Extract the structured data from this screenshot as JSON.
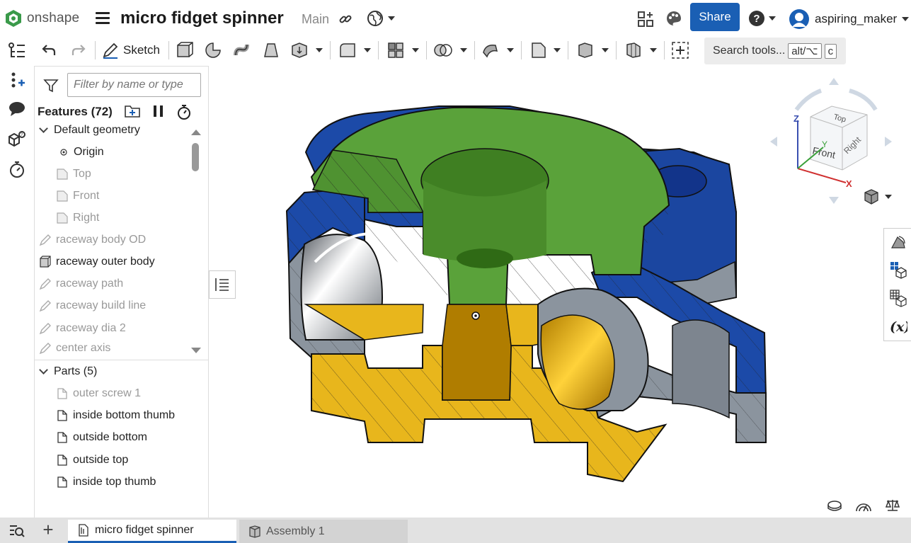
{
  "header": {
    "logo_text": "onshape",
    "doc_title": "micro fidget spinner",
    "branch": "Main",
    "share_label": "Share",
    "user_name": "aspiring_maker"
  },
  "toolbar": {
    "sketch_label": "Sketch",
    "search_label": "Search tools...",
    "shortcut_key1": "alt/⌥",
    "shortcut_key2": "c"
  },
  "panel": {
    "filter_placeholder": "Filter by name or type",
    "features_title": "Features (72)",
    "groups": {
      "default_geometry": "Default geometry",
      "parts": "Parts (5)"
    },
    "features": [
      {
        "label": "Origin",
        "icon": "origin-icon"
      },
      {
        "label": "Top",
        "icon": "plane-icon"
      },
      {
        "label": "Front",
        "icon": "plane-icon"
      },
      {
        "label": "Right",
        "icon": "plane-icon"
      },
      {
        "label": "raceway body OD",
        "icon": "sketch-icon"
      },
      {
        "label": "raceway outer body",
        "icon": "extrude-icon"
      },
      {
        "label": "raceway path",
        "icon": "sketch-icon"
      },
      {
        "label": "raceway build line",
        "icon": "sketch-icon"
      },
      {
        "label": "raceway dia 2",
        "icon": "sketch-icon"
      },
      {
        "label": "center axis",
        "icon": "sketch-icon"
      }
    ],
    "parts": [
      {
        "label": "outer screw 1",
        "icon": "part-icon"
      },
      {
        "label": "inside bottom thumb",
        "icon": "part-icon"
      },
      {
        "label": "outside bottom",
        "icon": "part-icon"
      },
      {
        "label": "outside top",
        "icon": "part-icon"
      },
      {
        "label": "inside top thumb",
        "icon": "part-icon"
      }
    ]
  },
  "viewcube": {
    "top": "Top",
    "front": "Front",
    "right": "Right",
    "axis_x": "X",
    "axis_y": "Y",
    "axis_z": "Z"
  },
  "tabs": [
    {
      "label": "micro fidget spinner",
      "active": true
    },
    {
      "label": "Assembly 1",
      "active": false
    }
  ],
  "colors": {
    "accent": "#1a5fb4",
    "part_green": "#5aa23a",
    "part_blue": "#1c4aa8",
    "part_yellow": "#e8b61c",
    "part_gray": "#8b949e"
  }
}
